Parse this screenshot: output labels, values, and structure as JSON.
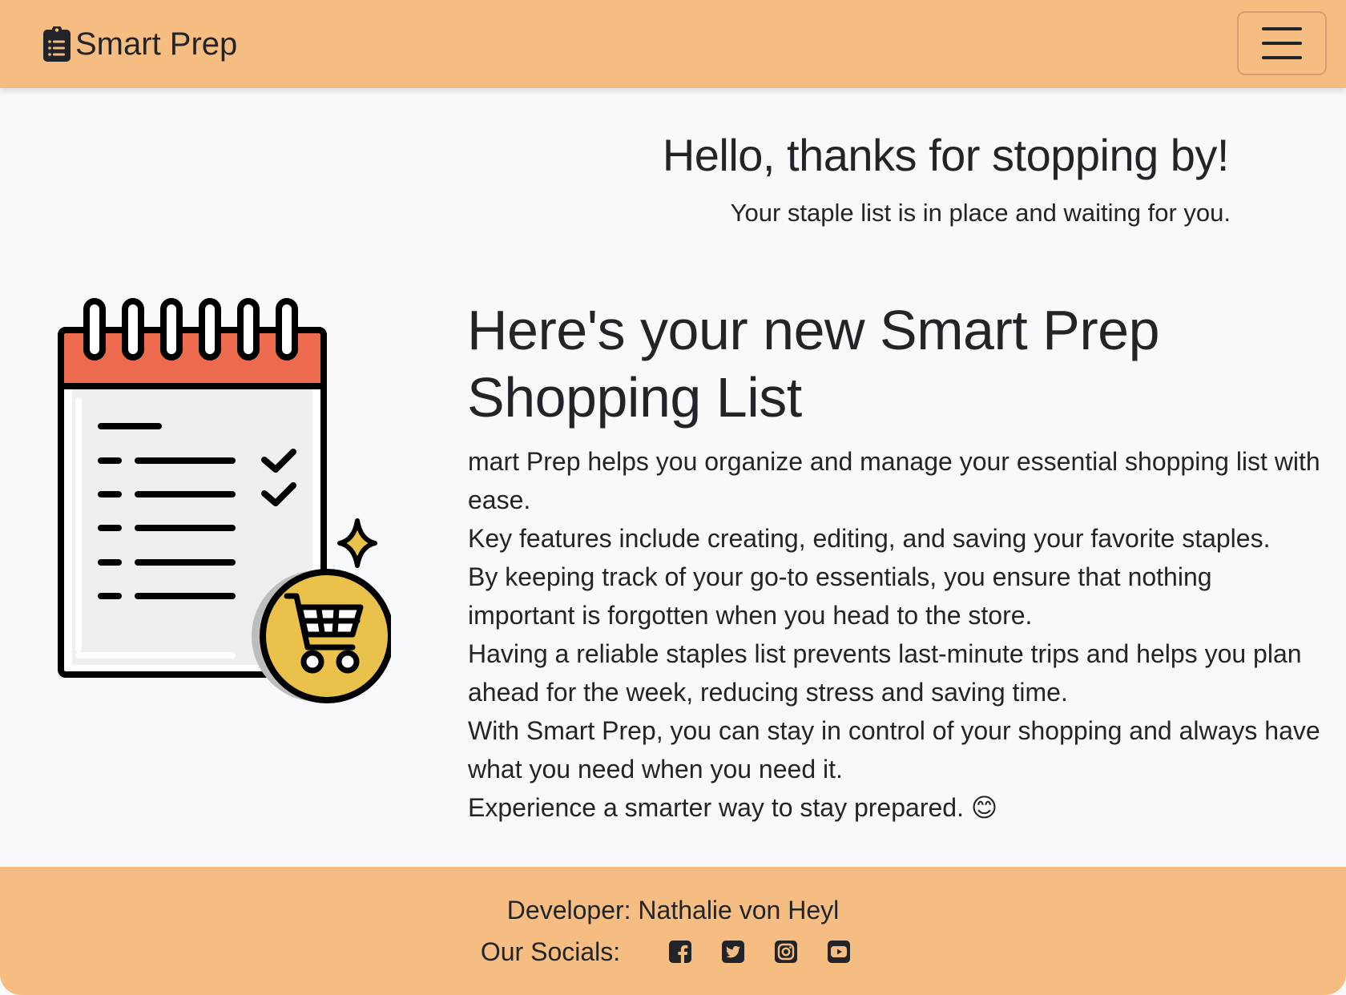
{
  "navbar": {
    "brand_text": "Smart Prep",
    "brand_icon": "clipboard-list-icon",
    "toggler_icon": "hamburger-menu-icon"
  },
  "hero": {
    "title": "Hello, thanks for stopping by!",
    "subtitle": "Your staple list is in place and waiting for you."
  },
  "illustration": {
    "icon": "shopping-list-cart-illustration"
  },
  "content": {
    "title": "Here's your new Smart Prep Shopping List",
    "paragraphs": [
      "mart Prep helps you organize and manage your essential shopping list with ease.",
      "Key features include creating, editing, and saving your favorite staples.",
      "By keeping track of your go-to essentials, you ensure that nothing important is forgotten when you head to the store.",
      "Having a reliable staples list prevents last-minute trips and helps you plan ahead for the week, reducing stress and saving time.",
      "With Smart Prep, you can stay in control of your shopping and always have what you need when you need it.",
      "Experience a smarter way to stay prepared. 😊"
    ]
  },
  "footer": {
    "developer": "Developer: Nathalie von Heyl",
    "socials_label": "Our Socials:",
    "socials": [
      {
        "icon": "facebook-icon"
      },
      {
        "icon": "twitter-icon"
      },
      {
        "icon": "instagram-icon"
      },
      {
        "icon": "youtube-icon"
      }
    ]
  },
  "colors": {
    "nav_footer_bg": "#f6bd82",
    "page_bg": "#f8f9fb",
    "text": "#212529",
    "calendar_red": "#ec6b4f",
    "cart_yellow": "#eac14a"
  }
}
